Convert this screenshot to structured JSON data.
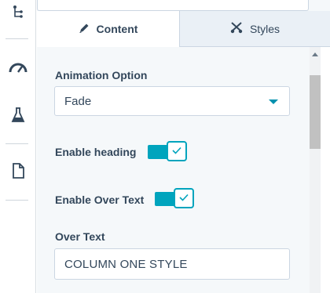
{
  "tabs": [
    {
      "label": "Content",
      "icon": "pencil-icon",
      "active": true
    },
    {
      "label": "Styles",
      "icon": "scissors-icon",
      "active": false
    }
  ],
  "sidebar": {
    "icons": [
      "tree-structure-icon",
      "speedometer-icon",
      "flask-icon",
      "document-icon"
    ]
  },
  "fields": {
    "animation_option": {
      "label": "Animation Option",
      "value": "Fade"
    },
    "enable_heading": {
      "label": "Enable heading",
      "checked": true
    },
    "enable_over_text": {
      "label": "Enable Over Text",
      "checked": true
    },
    "over_text": {
      "label": "Over Text",
      "value": "COLUMN ONE STYLE"
    }
  },
  "colors": {
    "accent": "#00a4bd",
    "text": "#33475b",
    "panel_bg": "#f5f8fa"
  }
}
